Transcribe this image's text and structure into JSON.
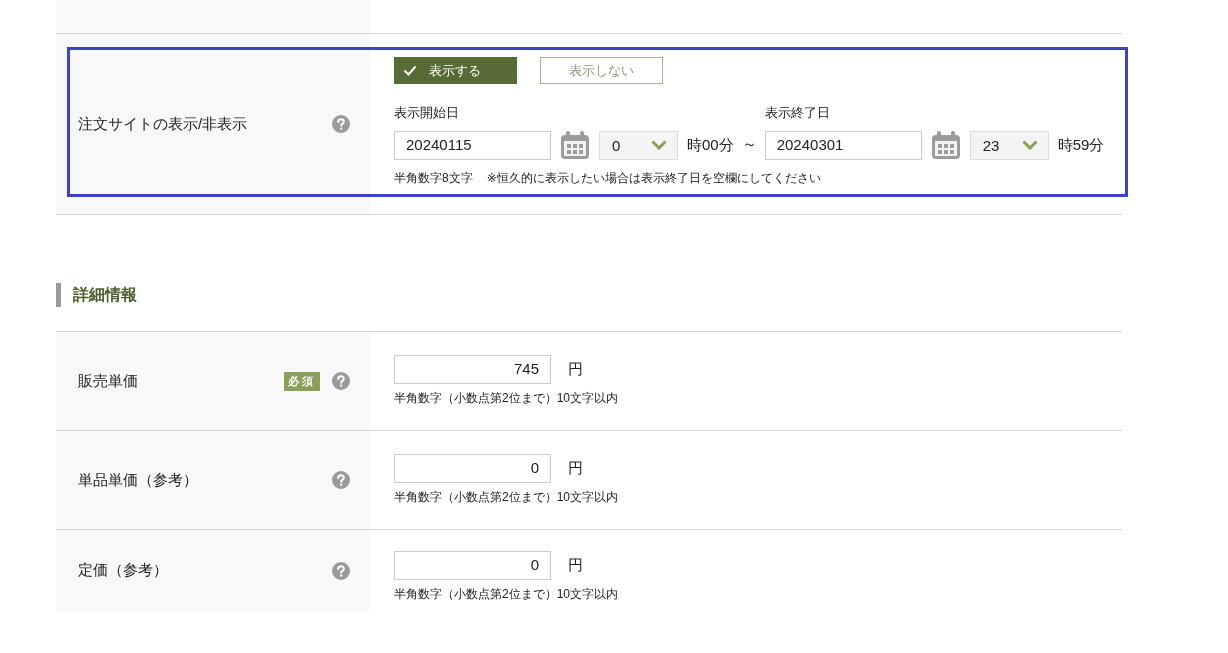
{
  "visibility_row": {
    "label": "注文サイトの表示/非表示",
    "highlighted": true,
    "options": [
      {
        "label": "表示する",
        "selected": true
      },
      {
        "label": "表示しない",
        "selected": false
      }
    ],
    "start": {
      "label": "表示開始日",
      "date": "20240115",
      "hour": "0",
      "suffix": "時00分"
    },
    "separator": "～",
    "end": {
      "label": "表示終了日",
      "date": "20240301",
      "hour": "23",
      "suffix": "時59分"
    },
    "notes": [
      "半角数字8文字",
      "※恒久的に表示したい場合は表示終了日を空欄にしてください"
    ]
  },
  "section_title": "詳細情報",
  "price_rows": [
    {
      "label": "販売単価",
      "badge": "必須",
      "value": "745",
      "unit": "円",
      "hint": "半角数字（小数点第2位まで）10文字以内"
    },
    {
      "label": "単品単価（参考）",
      "value": "0",
      "unit": "円",
      "hint": "半角数字（小数点第2位まで）10文字以内"
    },
    {
      "label": "定価（参考）",
      "value": "0",
      "unit": "円",
      "hint": "半角数字（小数点第2位まで）10文字以内"
    }
  ]
}
